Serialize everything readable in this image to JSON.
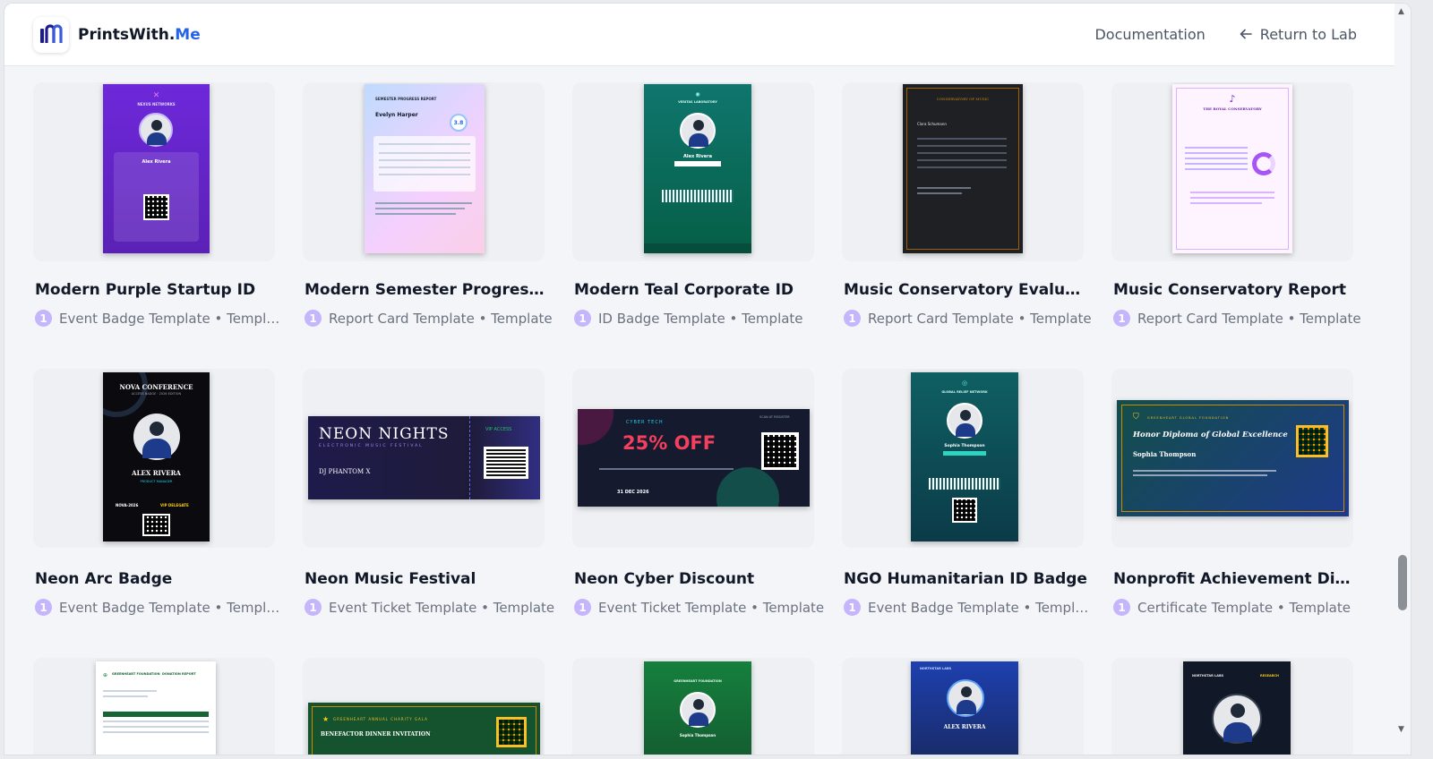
{
  "header": {
    "brand_name": "PrintsWith.",
    "brand_accent": "Me",
    "documentation_label": "Documentation",
    "return_label": "Return to Lab"
  },
  "row1": [
    {
      "title": "Modern Purple Startup ID",
      "meta": "Event Badge Template • Templa...",
      "count": "1"
    },
    {
      "title": "Modern Semester Progress R...",
      "meta": "Report Card Template • Template",
      "count": "1"
    },
    {
      "title": "Modern Teal Corporate ID",
      "meta": "ID Badge Template • Template",
      "count": "1"
    },
    {
      "title": "Music Conservatory Evaluati...",
      "meta": "Report Card Template • Template",
      "count": "1"
    },
    {
      "title": "Music Conservatory Report",
      "meta": "Report Card Template • Template",
      "count": "1"
    }
  ],
  "row2": [
    {
      "title": "Neon Arc Badge",
      "meta": "Event Badge Template • Templa...",
      "count": "1"
    },
    {
      "title": "Neon Music Festival",
      "meta": "Event Ticket Template • Template",
      "count": "1"
    },
    {
      "title": "Neon Cyber Discount",
      "meta": "Event Ticket Template • Template",
      "count": "1"
    },
    {
      "title": "NGO Humanitarian ID Badge",
      "meta": "Event Badge Template • Templa...",
      "count": "1"
    },
    {
      "title": "Nonprofit Achievement Diplo...",
      "meta": "Certificate Template • Template",
      "count": "1"
    }
  ],
  "previews": {
    "purple_id": {
      "org": "NEXUS NETWORKS",
      "name": "Alex Rivera"
    },
    "semester": {
      "heading": "SEMESTER PROGRESS REPORT",
      "student": "Evelyn Harper",
      "gpa": "3.8"
    },
    "teal_id": {
      "org": "VERITAS LABORATORY",
      "name": "Alex Rivera"
    },
    "conservatory_eval": {
      "heading": "CONSERVATORY OF MUSIC",
      "name": "Clara Schumann"
    },
    "royal": {
      "heading": "THE ROYAL CONSERVATORY"
    },
    "neon_arc": {
      "heading": "NOVA CONFERENCE",
      "sub": "ACCESS BADGE · 2026 EDITION",
      "name": "ALEX RIVERA",
      "role": "PRODUCT MANAGER",
      "code": "NOVA-2026",
      "tier": "VIP DELEGATE"
    },
    "neon_music": {
      "heading": "NEON NIGHTS",
      "sub": "ELECTRONIC MUSIC FESTIVAL",
      "artist": "DJ PHANTOM X",
      "vip": "VIP ACCESS"
    },
    "cyber": {
      "label": "CYBER TECH",
      "offer": "25% OFF",
      "date": "31 DEC 2026",
      "scan": "SCAN AT REGISTER"
    },
    "ngo": {
      "org": "GLOBAL RELIEF NETWORK",
      "name": "Sophia Thompson"
    },
    "diploma": {
      "org": "GREENHEART GLOBAL FOUNDATION",
      "heading": "Honor Diploma of Global Excellence",
      "name": "Sophia Thompson"
    },
    "donation": {
      "org": "GREENHEART FOUNDATION",
      "heading": "DONATION REPORT"
    },
    "gala": {
      "heading": "GREENHEART ANNUAL CHARITY GALA",
      "sub": "BENEFACTOR DINNER INVITATION"
    },
    "green_id": {
      "org": "GREENHEART FOUNDATION",
      "name": "Sophia Thompson"
    },
    "northstar_blue": {
      "org": "NORTHSTAR LABS",
      "name": "ALEX RIVERA"
    },
    "northstar_dark": {
      "org": "NORTHSTAR LABS",
      "tag": "RESEARCH"
    }
  }
}
